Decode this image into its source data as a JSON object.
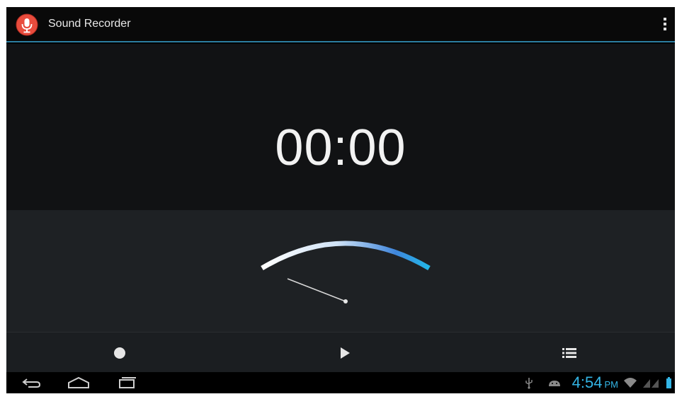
{
  "app": {
    "title": "Sound Recorder",
    "icon": "microphone-icon",
    "accent_color": "#2c7fa2"
  },
  "timer": {
    "value": "00:00"
  },
  "meter": {
    "level": 0.0
  },
  "controls": {
    "record_icon": "record-icon",
    "play_icon": "play-icon",
    "list_icon": "recordings-list-icon"
  },
  "system_bar": {
    "time": "4:54",
    "ampm": "PM",
    "clock_color": "#33b5e5",
    "icons": [
      "usb-icon",
      "android-debug-icon",
      "wifi-icon",
      "signal-icon",
      "battery-icon"
    ]
  }
}
